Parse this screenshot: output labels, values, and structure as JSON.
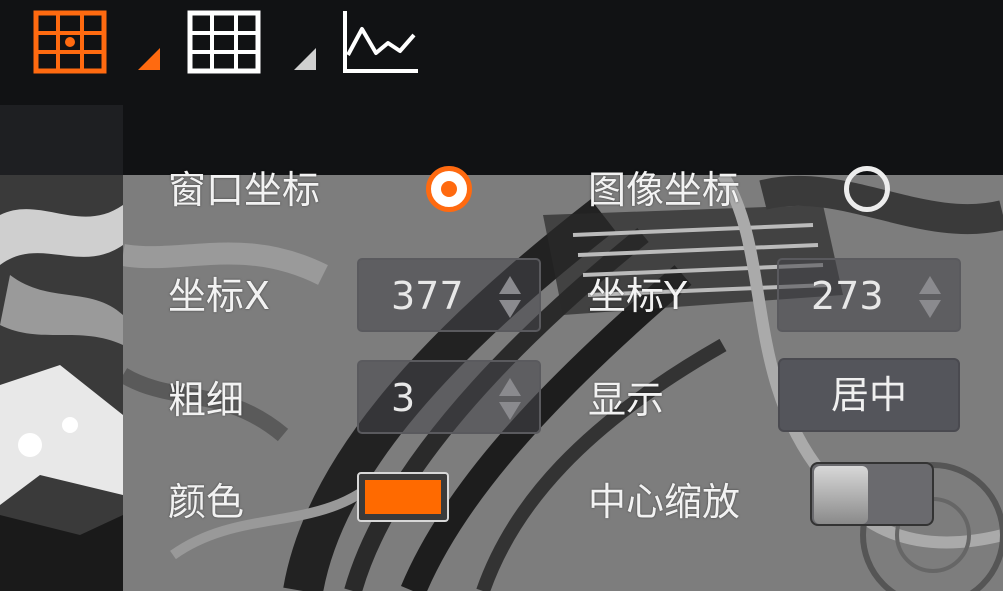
{
  "colors": {
    "accent": "#ff6a10",
    "toolbar_bg": "#111214",
    "swatch": "#ff6a00"
  },
  "toolbar": {
    "icons": [
      "grid-crosshair-icon",
      "grid-icon",
      "line-chart-icon"
    ]
  },
  "panel": {
    "coord_mode": {
      "window_label": "窗口坐标",
      "image_label": "图像坐标",
      "selected": "window"
    },
    "x": {
      "label": "坐标X",
      "value": "377"
    },
    "y": {
      "label": "坐标Y",
      "value": "273"
    },
    "thickness": {
      "label": "粗细",
      "value": "3"
    },
    "display": {
      "label": "显示",
      "button": "居中"
    },
    "color": {
      "label": "颜色"
    },
    "center_zoom": {
      "label": "中心缩放",
      "on": false
    }
  }
}
